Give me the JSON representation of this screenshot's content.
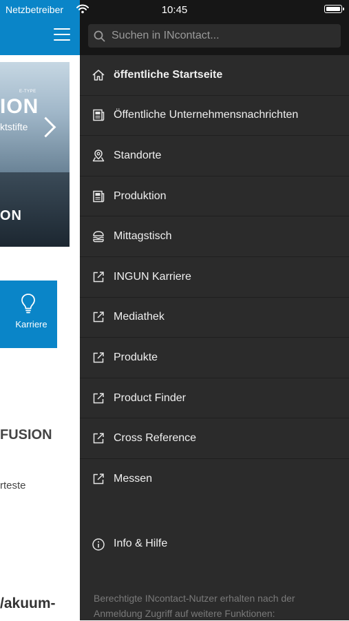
{
  "status_bar": {
    "carrier": "Netzbetreiber",
    "time": "10:45",
    "battery_level": 1.0
  },
  "main_page": {
    "banner": {
      "etype": "E-TYPE",
      "headline": "ION",
      "subline": "ktstifte",
      "bottom": "ON"
    },
    "tile": {
      "label": "Karriere",
      "icon": "lightbulb-icon"
    },
    "text_fusion": "FUSION",
    "text_teste": "rteste",
    "text_vakuum": "/akuum-"
  },
  "drawer": {
    "search": {
      "placeholder": "Suchen in INcontact..."
    },
    "items": [
      {
        "label": "öffentliche Startseite",
        "icon": "home-icon",
        "active": true
      },
      {
        "label": "Öffentliche Unternehmensnachrichten",
        "icon": "news-icon"
      },
      {
        "label": "Standorte",
        "icon": "map-pin-icon"
      },
      {
        "label": "Produktion",
        "icon": "news-icon"
      },
      {
        "label": "Mittagstisch",
        "icon": "burger-icon"
      },
      {
        "label": "INGUN Karriere",
        "icon": "external-link-icon"
      },
      {
        "label": "Mediathek",
        "icon": "external-link-icon"
      },
      {
        "label": "Produkte",
        "icon": "external-link-icon"
      },
      {
        "label": "Product Finder",
        "icon": "external-link-icon"
      },
      {
        "label": "Cross Reference",
        "icon": "external-link-icon"
      },
      {
        "label": "Messen",
        "icon": "external-link-icon"
      }
    ],
    "info": {
      "label": "Info & Hilfe",
      "icon": "info-icon"
    },
    "footer_note": "Berechtigte INcontact-Nutzer erhalten nach der Anmeldung Zugriff auf weitere Funktionen:"
  },
  "colors": {
    "brand_blue": "#0a85c8",
    "drawer_bg": "#2b2b2b",
    "search_bg": "#161616"
  }
}
